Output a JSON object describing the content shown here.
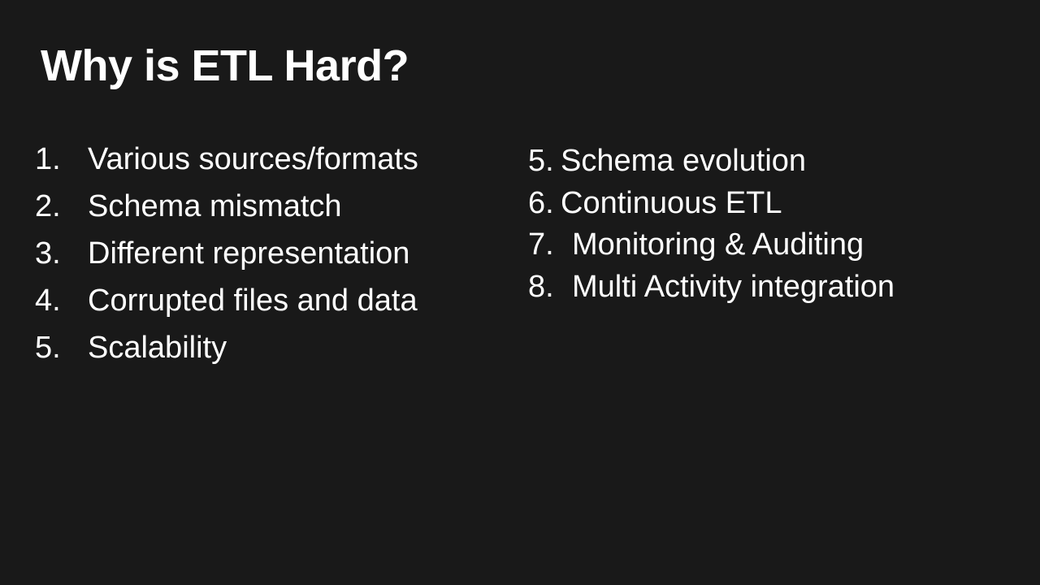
{
  "slide": {
    "title": "Why is ETL Hard?",
    "left_items": [
      {
        "number": "1.",
        "text": "Various sources/formats"
      },
      {
        "number": "2.",
        "text": "Schema mismatch"
      },
      {
        "number": "3.",
        "text": "Different representation"
      },
      {
        "number": "4.",
        "text": "Corrupted files and data"
      },
      {
        "number": "5.",
        "text": "Scalability"
      }
    ],
    "right_items": [
      {
        "number": "5.",
        "text": "Schema evolution"
      },
      {
        "number": "6.",
        "text": "Continuous ETL"
      },
      {
        "number": "7.",
        "text": "Monitoring & Auditing"
      },
      {
        "number": "8.",
        "text": "Multi Activity integration"
      }
    ]
  }
}
